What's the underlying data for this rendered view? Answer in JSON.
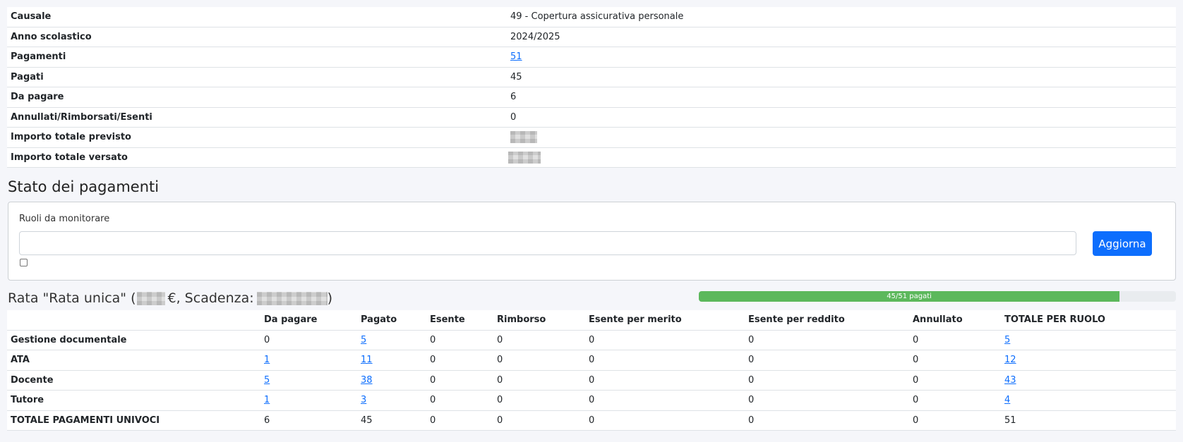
{
  "summary": [
    {
      "label": "Causale",
      "value": "49 - Copertura assicurativa personale"
    },
    {
      "label": "Anno scolastico",
      "value": "2024/2025"
    },
    {
      "label": "Pagamenti",
      "value": "51"
    },
    {
      "label": "Pagati",
      "value": "45"
    },
    {
      "label": "Da pagare",
      "value": "6"
    },
    {
      "label": "Annullati/Rimborsati/Esenti",
      "value": "0"
    },
    {
      "label": "Importo totale previsto",
      "value": ""
    },
    {
      "label": "Importo totale versato",
      "value": ""
    }
  ],
  "section_title": "Stato dei pagamenti",
  "filter": {
    "label": "Ruoli da monitorare",
    "input_value": "",
    "button_label": "Aggiorna"
  },
  "rata": {
    "prefix": "Rata \"Rata unica\" (",
    "currency": "€, Scadenza:",
    "suffix": ")",
    "progress_label": "45/51 pagati",
    "progress_fraction": 0.882
  },
  "roles_table": {
    "headers": [
      "",
      "Da pagare",
      "Pagato",
      "Esente",
      "Rimborso",
      "Esente per merito",
      "Esente per reddito",
      "Annullato",
      "TOTALE PER RUOLO"
    ],
    "rows": [
      [
        "Gestione documentale",
        "0",
        "5",
        "0",
        "0",
        "0",
        "0",
        "0",
        "5"
      ],
      [
        "ATA",
        "1",
        "11",
        "0",
        "0",
        "0",
        "0",
        "0",
        "12"
      ],
      [
        "Docente",
        "5",
        "38",
        "0",
        "0",
        "0",
        "0",
        "0",
        "43"
      ],
      [
        "Tutore",
        "1",
        "3",
        "0",
        "0",
        "0",
        "0",
        "0",
        "4"
      ],
      [
        "TOTALE PAGAMENTI UNIVOCI",
        "6",
        "45",
        "0",
        "0",
        "0",
        "0",
        "0",
        "51"
      ]
    ]
  }
}
